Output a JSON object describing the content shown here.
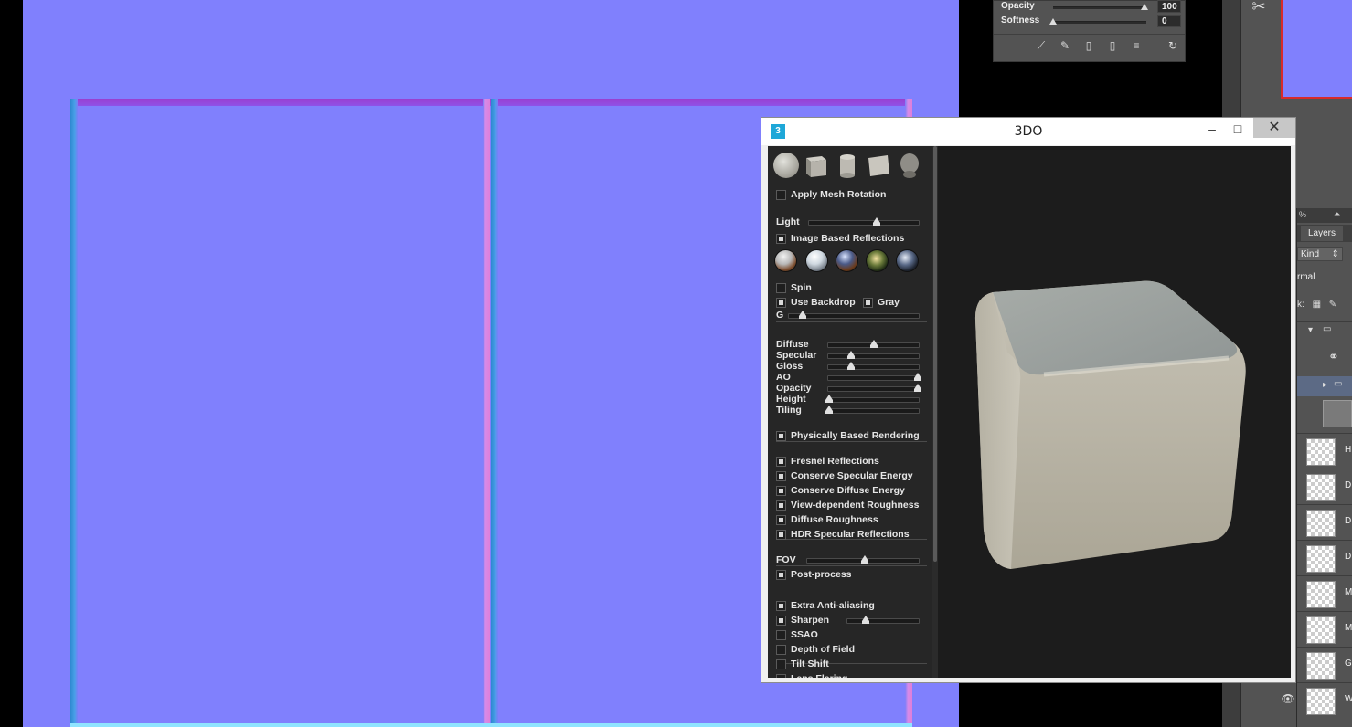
{
  "window": {
    "title": "3DO",
    "icon_glyph": "3",
    "minimize_glyph": "–",
    "maximize_glyph": "□",
    "close_glyph": "✕"
  },
  "primitives": [
    "sphere",
    "cube",
    "cylinder",
    "plane",
    "head"
  ],
  "controls": {
    "apply_mesh_rotation": {
      "label": "Apply Mesh Rotation",
      "checked": false
    },
    "light": {
      "label": "Light",
      "value": 0.62
    },
    "image_based_reflections": {
      "label": "Image Based Reflections",
      "checked": true
    },
    "spin": {
      "label": "Spin",
      "checked": false
    },
    "use_backdrop": {
      "label": "Use Backdrop",
      "checked": true
    },
    "gray": {
      "label": "Gray",
      "checked": true
    },
    "g": {
      "label": "G",
      "value": 0.1
    }
  },
  "material": [
    {
      "label": "Diffuse",
      "value": 0.5
    },
    {
      "label": "Specular",
      "value": 0.25
    },
    {
      "label": "Gloss",
      "value": 0.25
    },
    {
      "label": "AO",
      "value": 1.0
    },
    {
      "label": "Opacity",
      "value": 1.0
    },
    {
      "label": "Height",
      "value": 0.0
    },
    {
      "label": "Tiling",
      "value": 0.0
    }
  ],
  "pbr": {
    "label": "Physically Based Rendering",
    "checked": true
  },
  "pbr_options": [
    {
      "label": "Fresnel Reflections",
      "checked": true
    },
    {
      "label": "Conserve Specular Energy",
      "checked": true
    },
    {
      "label": "Conserve Diffuse Energy",
      "checked": true
    },
    {
      "label": "View-dependent Roughness",
      "checked": true
    },
    {
      "label": "Diffuse Roughness",
      "checked": true
    },
    {
      "label": "HDR Specular Reflections",
      "checked": true
    }
  ],
  "fov": {
    "label": "FOV",
    "value": 0.52
  },
  "post_process": {
    "label": "Post-process",
    "checked": true
  },
  "post_options": [
    {
      "label": "Extra Anti-aliasing",
      "checked": true
    },
    {
      "label": "Sharpen",
      "checked": true,
      "slider": 0.25
    },
    {
      "label": "SSAO",
      "checked": false
    },
    {
      "label": "Depth of Field",
      "checked": false
    },
    {
      "label": "Tilt Shift",
      "checked": false
    },
    {
      "label": "Lens Flaring",
      "checked": false
    }
  ],
  "brush_panel": {
    "opacity_label": "Opacity",
    "opacity_value": "100",
    "softness_label": "Softness",
    "softness_value": "0"
  },
  "layers_panel": {
    "zoom_suffix": "%",
    "tab_label": "Layers",
    "filter_kind": "Kind",
    "blend_mode": "rmal",
    "lock_label": "k:",
    "layer_initials": [
      "H",
      "D",
      "D",
      "D",
      "M",
      "M",
      "G",
      "W"
    ]
  },
  "colors": {
    "normal_map_base": "#8080fd",
    "window_bg": "#f0f0f0",
    "panel_bg": "#262626",
    "viewport_bg": "#1c1c1c",
    "accent_icon": "#1ea7d8"
  }
}
